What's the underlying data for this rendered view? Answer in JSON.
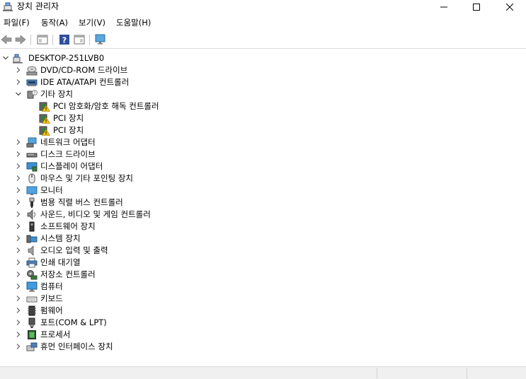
{
  "window": {
    "title": "장치 관리자",
    "controls": [
      "minimize",
      "maximize",
      "close"
    ]
  },
  "menu": [
    {
      "label": "파일(F)"
    },
    {
      "label": "동작(A)"
    },
    {
      "label": "보기(V)"
    },
    {
      "label": "도움말(H)"
    }
  ],
  "toolbar": [
    "back-icon",
    "forward-icon",
    "properties-pane-icon",
    "help-icon",
    "view-pane-icon",
    "monitor-scan-icon"
  ],
  "tree": {
    "root": {
      "label": "DESKTOP-251LVB0",
      "expanded": true,
      "icon": "computer-icon"
    },
    "items": [
      {
        "label": "DVD/CD-ROM 드라이브",
        "expanded": false,
        "icon": "dvd-drive-icon"
      },
      {
        "label": "IDE ATA/ATAPI 컨트롤러",
        "expanded": false,
        "icon": "ide-controller-icon"
      },
      {
        "label": "기타 장치",
        "expanded": true,
        "icon": "unknown-device-icon",
        "children": [
          {
            "label": "PCI 암호화/암호 해독 컨트롤러",
            "icon": "warning-device-icon"
          },
          {
            "label": "PCI 장치",
            "icon": "warning-device-icon"
          },
          {
            "label": "PCI 장치",
            "icon": "warning-device-icon"
          }
        ]
      },
      {
        "label": "네트워크 어댑터",
        "expanded": false,
        "icon": "network-adapter-icon"
      },
      {
        "label": "디스크 드라이브",
        "expanded": false,
        "icon": "disk-drive-icon"
      },
      {
        "label": "디스플레이 어댑터",
        "expanded": false,
        "icon": "display-adapter-icon"
      },
      {
        "label": "마우스 및 기타 포인팅 장치",
        "expanded": false,
        "icon": "mouse-icon"
      },
      {
        "label": "모니터",
        "expanded": false,
        "icon": "monitor-icon"
      },
      {
        "label": "범용 직렬 버스 컨트롤러",
        "expanded": false,
        "icon": "usb-icon"
      },
      {
        "label": "사운드, 비디오 및 게임 컨트롤러",
        "expanded": false,
        "icon": "sound-icon"
      },
      {
        "label": "소프트웨어 장치",
        "expanded": false,
        "icon": "software-device-icon"
      },
      {
        "label": "시스템 장치",
        "expanded": false,
        "icon": "system-device-icon"
      },
      {
        "label": "오디오 입력 및 출력",
        "expanded": false,
        "icon": "audio-io-icon"
      },
      {
        "label": "인쇄 대기열",
        "expanded": false,
        "icon": "printer-icon"
      },
      {
        "label": "저장소 컨트롤러",
        "expanded": false,
        "icon": "storage-controller-icon"
      },
      {
        "label": "컴퓨터",
        "expanded": false,
        "icon": "computer-monitor-icon"
      },
      {
        "label": "키보드",
        "expanded": false,
        "icon": "keyboard-icon"
      },
      {
        "label": "펌웨어",
        "expanded": false,
        "icon": "firmware-icon"
      },
      {
        "label": "포트(COM & LPT)",
        "expanded": false,
        "icon": "port-icon"
      },
      {
        "label": "프로세서",
        "expanded": false,
        "icon": "processor-icon"
      },
      {
        "label": "휴먼 인터페이스 장치",
        "expanded": false,
        "icon": "hid-icon"
      }
    ]
  },
  "statusbar": {
    "text": ""
  }
}
